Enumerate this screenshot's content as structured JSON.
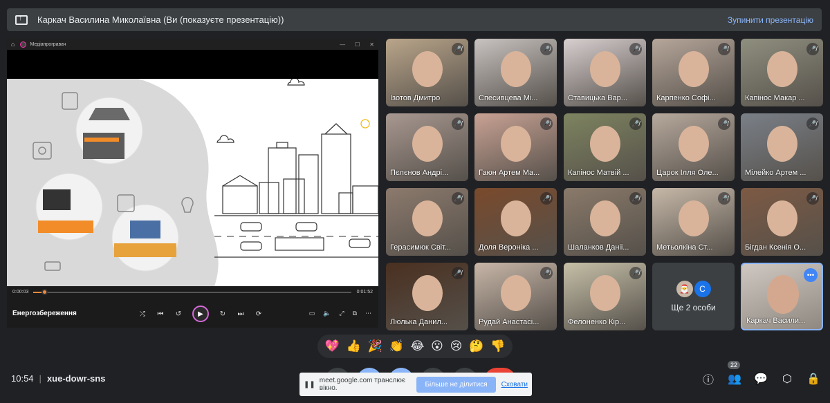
{
  "presenting": {
    "title": "Каркач Василина Миколаївна (Ви (показуєте презентацію))",
    "stop_label": "Зупинити презентацію"
  },
  "player": {
    "app_name": "Медіапрогравач",
    "time_current": "0:00:03",
    "time_total": "0:01:52",
    "progress": 0.035,
    "media_title": "Енергозбереження"
  },
  "tiles": [
    {
      "name": "Ізотов Дмитро",
      "bg": "#b9a58a"
    },
    {
      "name": "Спесивцева Мі...",
      "bg": "#c8c2c0"
    },
    {
      "name": "Ставицька Вар...",
      "bg": "#d8cfd0"
    },
    {
      "name": "Карпенко Софі...",
      "bg": "#b6a69a"
    },
    {
      "name": "Капінос Макар ...",
      "bg": "#8f8f7f"
    },
    {
      "name": "Пєлєнов Андрі...",
      "bg": "#a89890"
    },
    {
      "name": "Гаюн Артем Ма...",
      "bg": "#c9a294"
    },
    {
      "name": "Капінос Матвій ...",
      "bg": "#7e8460"
    },
    {
      "name": "Царок Ілля Оле...",
      "bg": "#b7a99d"
    },
    {
      "name": "Мілейко Артем ...",
      "bg": "#7a8088"
    },
    {
      "name": "Герасимюк Світ...",
      "bg": "#8c7a6d"
    },
    {
      "name": "Доля Вероніка ...",
      "bg": "#7a4a2c"
    },
    {
      "name": "Шаланков Даніі...",
      "bg": "#8a7a6a"
    },
    {
      "name": "Метьолкіна Ст...",
      "bg": "#c6b8a8"
    },
    {
      "name": "Бігдан Ксенія О...",
      "bg": "#7d5a44"
    },
    {
      "name": "Люлька Данил...",
      "bg": "#4a3020"
    },
    {
      "name": "Рудай Анастасі...",
      "bg": "#c8b6a8"
    },
    {
      "name": "Фелоненко Кір...",
      "bg": "#c6c0a8"
    }
  ],
  "more_tile": {
    "label": "Ще 2 особи",
    "avatar_letter": "С"
  },
  "self_tile": {
    "name": "Каркач Васили..."
  },
  "reactions": [
    "💖",
    "👍",
    "🎉",
    "👏",
    "😂",
    "😮",
    "😢",
    "🤔",
    "👎"
  ],
  "bottom": {
    "time": "10:54",
    "meeting_code": "xue-dowr-sns",
    "participants_count": "22"
  },
  "share_banner": {
    "message": "meet.google.com транслює вікно.",
    "stop_share_label": "Більше не ділитися",
    "hide_label": "Сховати"
  }
}
